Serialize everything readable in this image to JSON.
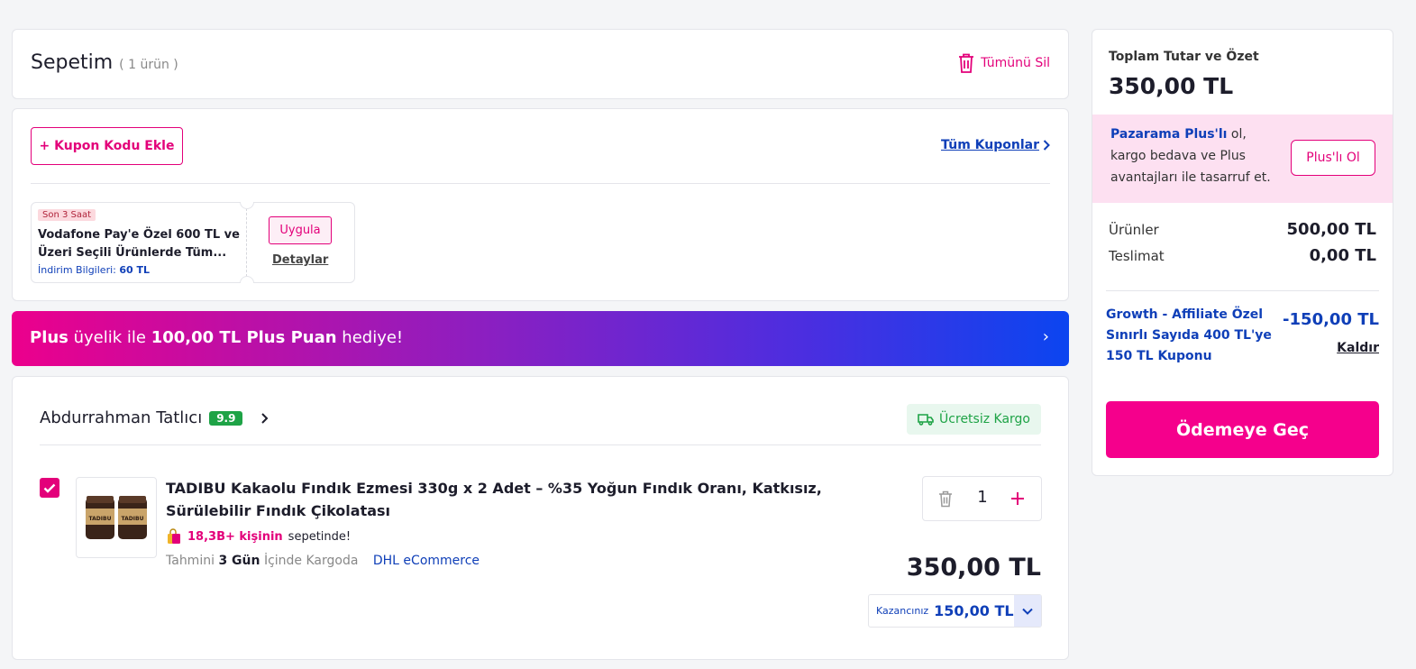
{
  "cart": {
    "title": "Sepetim",
    "count": "( 1 ürün )",
    "delete_all": "Tümünü Sil"
  },
  "coupons": {
    "add_button": "+ Kupon Kodu Ekle",
    "all_link": "Tüm Kuponlar",
    "ticket": {
      "tag": "Son 3 Saat",
      "description": "Vodafone Pay'e Özel 600 TL ve Üzeri Seçili Ürünlerde Tüm...",
      "info_label": "İndirim Bilgileri:",
      "info_value": "60 TL",
      "apply": "Uygula",
      "details": "Detaylar"
    }
  },
  "banner": {
    "part1": "Plus",
    "part2": " üyelik ile ",
    "part3": "100,00 TL Plus Puan",
    "part4": " hediye!",
    "chevron": "›"
  },
  "seller": {
    "name": "Abdurrahman Tatlıcı",
    "rating": "9.9",
    "shipping_badge": "Ücretsiz Kargo"
  },
  "product": {
    "name": "TADIBU Kakaolu Fındık Ezmesi 330g x 2 Adet – %35 Yoğun Fındık Oranı, Katkısız, Sürülebilir Fındık Çikolatası",
    "popularity_count": "18,3B+ kişinin",
    "popularity_suffix": "sepetinde!",
    "eta_prefix": "Tahmini",
    "eta_days": "3 Gün",
    "eta_suffix": "İçinde Kargoda",
    "carrier": "DHL eCommerce",
    "quantity": "1",
    "price": "350,00 TL",
    "savings_label": "Kazancınız",
    "savings_value": "150,00 TL",
    "image_label": "TADIBU"
  },
  "summary": {
    "label": "Toplam Tutar ve Özet",
    "total": "350,00 TL",
    "plus_brand": "Pazarama Plus'lı",
    "plus_text": " ol, kargo bedava ve Plus avantajları ile tasarruf et.",
    "plus_button": "Plus'lı Ol",
    "items_label": "Ürünler",
    "items_value": "500,00 TL",
    "delivery_label": "Teslimat",
    "delivery_value": "0,00 TL",
    "coupon_name": "Growth - Affiliate Özel Sınırlı Sayıda 400 TL'ye 150 TL Kuponu",
    "coupon_amount": "-150,00 TL",
    "remove": "Kaldır",
    "checkout": "Ödemeye Geç"
  },
  "colors": {
    "accent": "#e3007a",
    "link_blue": "#0f3fb8",
    "success_green": "#1ea346"
  }
}
